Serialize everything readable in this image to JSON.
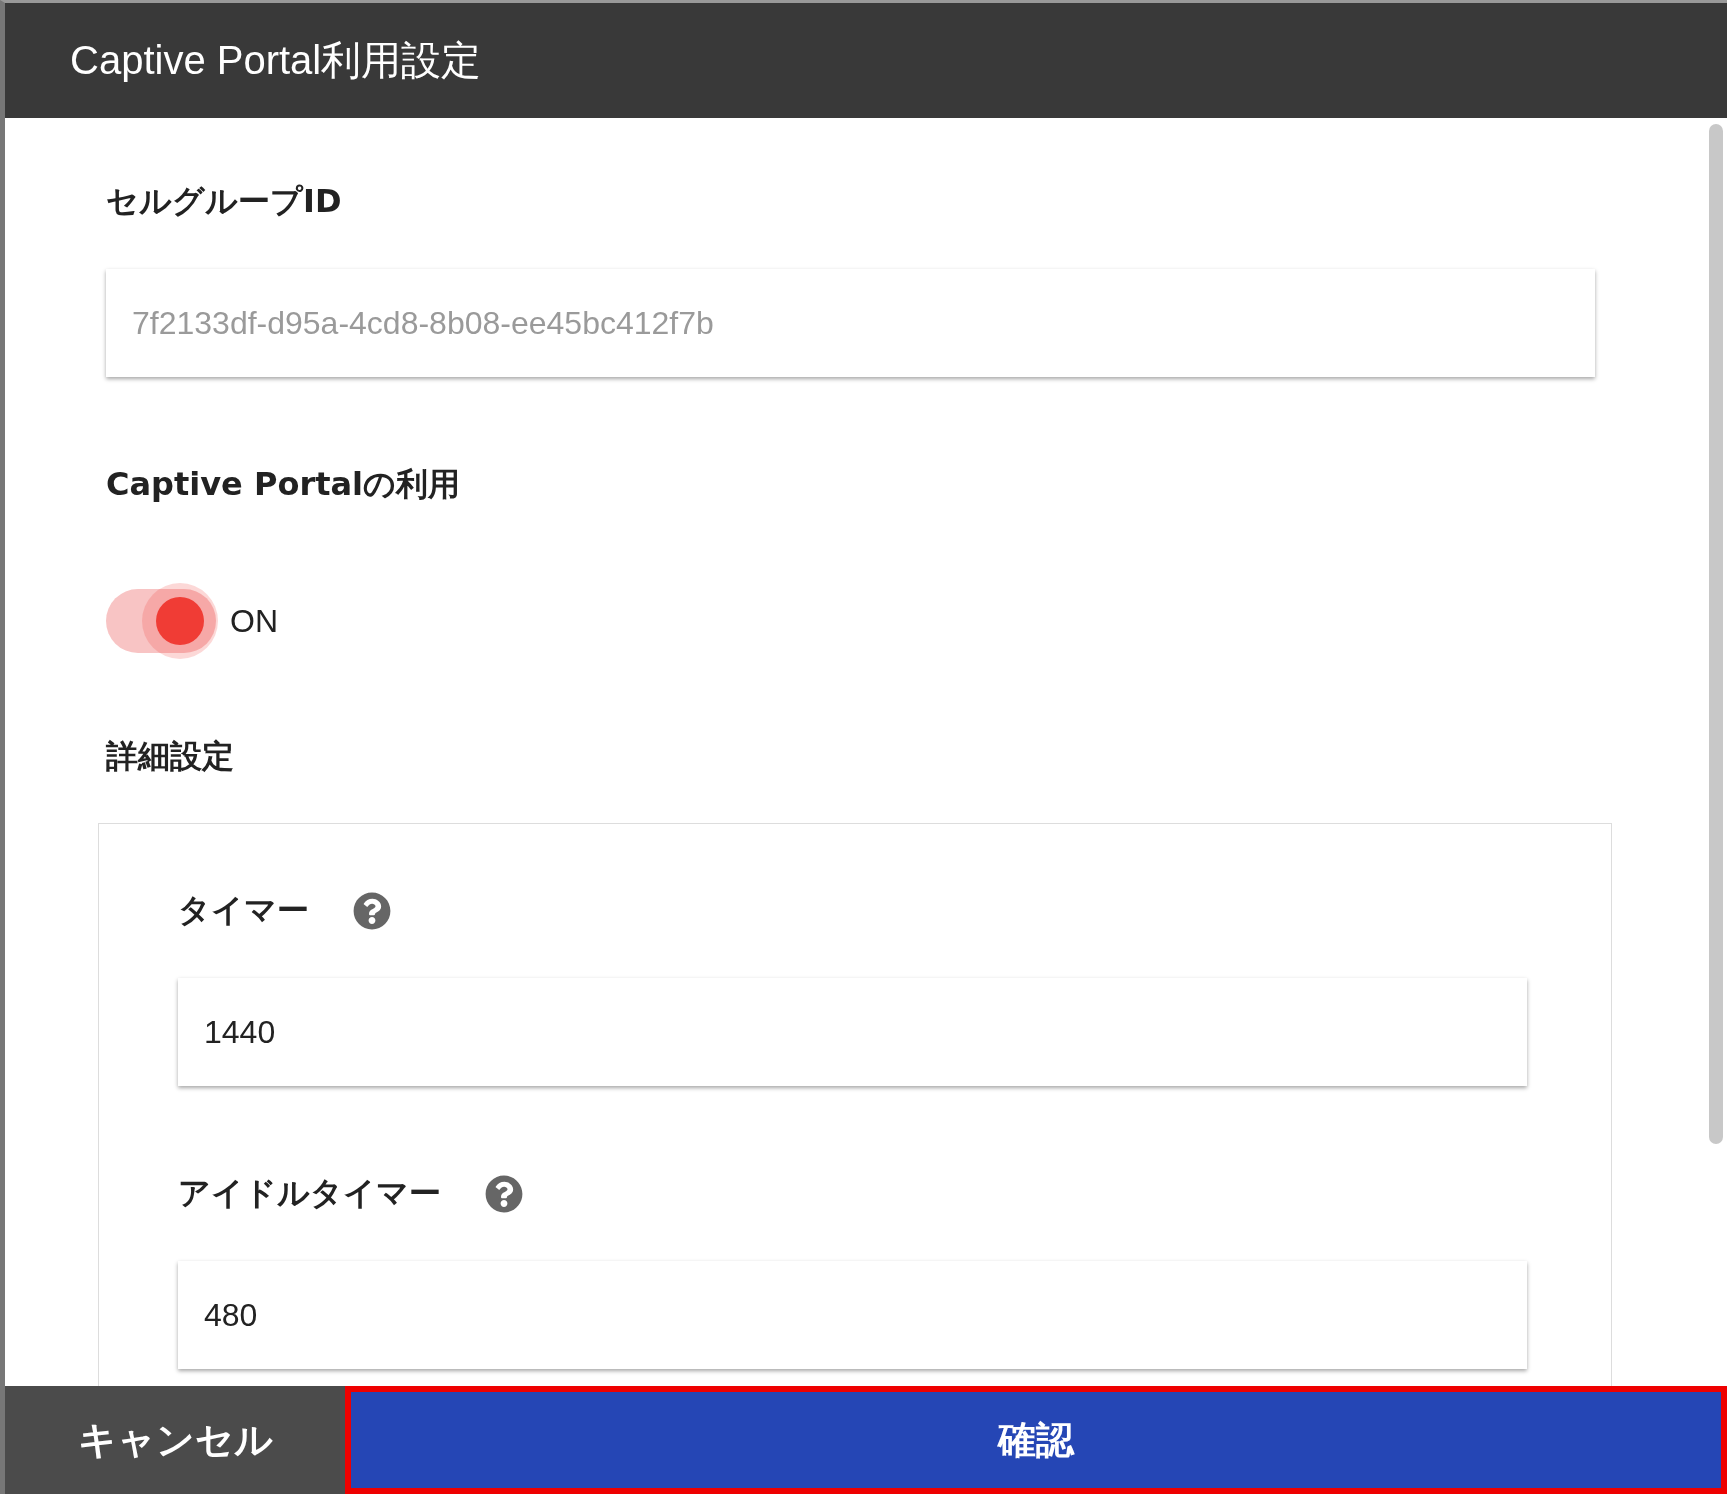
{
  "dialog": {
    "title": "Captive Portal利用設定"
  },
  "cell_group": {
    "label": "セルグループID",
    "placeholder": "7f2133df-d95a-4cd8-8b08-ee45bc412f7b"
  },
  "captive_portal": {
    "label": "Captive Portalの利用",
    "on": true,
    "state_label": "ON"
  },
  "details": {
    "label": "詳細設定",
    "fields": [
      {
        "label": "タイマー",
        "value": "1440"
      },
      {
        "label": "アイドルタイマー",
        "value": "480"
      }
    ]
  },
  "buttons": [
    {
      "kind": "cancel",
      "label": "キャンセル"
    },
    {
      "kind": "confirm",
      "label": "確認",
      "highlighted": true
    }
  ]
}
